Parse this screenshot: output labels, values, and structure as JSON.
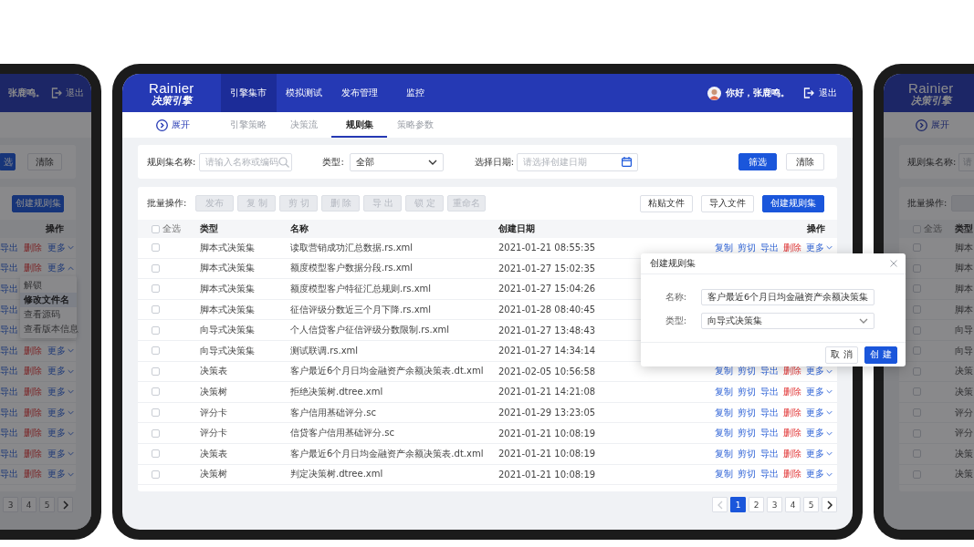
{
  "main": {
    "header": {
      "logo": {
        "latin": "Rainier",
        "chinese": "决策引擎"
      },
      "nav": [
        {
          "label": "引擎集市",
          "selected": true
        },
        {
          "label": "模拟测试",
          "selected": false
        },
        {
          "label": "发布管理",
          "selected": false
        },
        {
          "label": "监控",
          "selected": false
        }
      ],
      "greeting": "你好，张鹿鸣。",
      "logout": "退出"
    },
    "subnav": {
      "expand": "展开",
      "tabs": [
        {
          "label": "引擎策略",
          "selected": false
        },
        {
          "label": "决策流",
          "selected": false
        },
        {
          "label": "规则集",
          "selected": true
        },
        {
          "label": "策略参数",
          "selected": false
        }
      ]
    },
    "filter": {
      "name_field": {
        "label": "规则集名称:",
        "placeholder": "请输入名称或编码"
      },
      "type_field": {
        "label": "类型:",
        "value": "全部"
      },
      "date_field": {
        "label": "选择日期:",
        "placeholder": "请选择创建日期"
      },
      "buttons": [
        {
          "label": "筛选",
          "kind": "primary"
        },
        {
          "label": "清除",
          "kind": "default"
        }
      ]
    },
    "batch": {
      "label": "批量操作:",
      "buttons": [
        {
          "label": "发布",
          "disabled": true
        },
        {
          "label": "复 制",
          "disabled": true
        },
        {
          "label": "剪 切",
          "disabled": true
        },
        {
          "label": "删 除",
          "disabled": true
        },
        {
          "label": "导 出",
          "disabled": true
        },
        {
          "label": "锁 定",
          "disabled": true
        },
        {
          "label": "重命名",
          "disabled": true
        }
      ],
      "actions": [
        {
          "label": "粘贴文件",
          "kind": "default"
        },
        {
          "label": "导入文件",
          "kind": "default"
        },
        {
          "label": "创建规则集",
          "kind": "primary"
        }
      ]
    },
    "table": {
      "select_all": {
        "label": "全选",
        "checked": false
      },
      "columns": [
        "类型",
        "名称",
        "创建日期",
        "操作"
      ],
      "rows": [
        {
          "checked": false,
          "type": "脚本式决策集",
          "name": "读取营销成功汇总数据.rs.xml",
          "date": "2021-01-21 08:55:35",
          "actions": [
            {
              "label": "复制",
              "kind": "link"
            },
            {
              "label": "剪切",
              "kind": "link"
            },
            {
              "label": "导出",
              "kind": "link"
            },
            {
              "label": "删除",
              "kind": "danger"
            },
            {
              "label": "更多",
              "kind": "more",
              "expanded": false
            }
          ]
        },
        {
          "checked": false,
          "type": "脚本式决策集",
          "name": "额度模型客户数据分段.rs.xml",
          "date": "2021-01-27 15:02:35"
        },
        {
          "checked": false,
          "type": "脚本式决策集",
          "name": "额度模型客户特征汇总规则.rs.xml",
          "date": "2021-01-27 15:04:26"
        },
        {
          "checked": false,
          "type": "脚本式决策集",
          "name": "征信评级分数近三个月下降.rs.xml",
          "date": "2021-01-28 08:40:45"
        },
        {
          "checked": false,
          "type": "向导式决策集",
          "name": "个人信贷客户征信评级分数限制.rs.xml",
          "date": "2021-01-27 13:48:43"
        },
        {
          "checked": false,
          "type": "向导式决策集",
          "name": "测试联调.rs.xml",
          "date": "2021-01-27 14:34:14"
        },
        {
          "checked": false,
          "type": "决策表",
          "name": "客户最近6个月日均金融资产余额决策表.dt.xml",
          "date": "2021-02-05 10:56:58",
          "actions": [
            {
              "label": "复制",
              "kind": "link"
            },
            {
              "label": "剪切",
              "kind": "link"
            },
            {
              "label": "导出",
              "kind": "link"
            },
            {
              "label": "删除",
              "kind": "danger"
            },
            {
              "label": "更多",
              "kind": "more",
              "expanded": false
            }
          ]
        },
        {
          "checked": false,
          "type": "决策树",
          "name": "拒绝决策树.dtree.xml",
          "date": "2021-01-21 14:21:08",
          "actions": [
            {
              "label": "复制",
              "kind": "link"
            },
            {
              "label": "剪切",
              "kind": "link"
            },
            {
              "label": "导出",
              "kind": "link"
            },
            {
              "label": "删除",
              "kind": "danger"
            },
            {
              "label": "更多",
              "kind": "more",
              "expanded": false
            }
          ]
        },
        {
          "checked": false,
          "type": "评分卡",
          "name": "客户信用基础评分.sc",
          "date": "2021-01-29 13:23:05",
          "actions": [
            {
              "label": "复制",
              "kind": "link"
            },
            {
              "label": "剪切",
              "kind": "link"
            },
            {
              "label": "导出",
              "kind": "link"
            },
            {
              "label": "删除",
              "kind": "danger"
            },
            {
              "label": "更多",
              "kind": "more",
              "expanded": false
            }
          ]
        },
        {
          "checked": false,
          "type": "评分卡",
          "name": "信贷客户信用基础评分.sc",
          "date": "2021-01-21 10:08:19",
          "actions": [
            {
              "label": "复制",
              "kind": "link"
            },
            {
              "label": "剪切",
              "kind": "link"
            },
            {
              "label": "导出",
              "kind": "link"
            },
            {
              "label": "删除",
              "kind": "danger"
            },
            {
              "label": "更多",
              "kind": "more",
              "expanded": false
            }
          ]
        },
        {
          "checked": false,
          "type": "决策表",
          "name": "客户最近6个月日均金融资产余额决策表.dt.xml",
          "date": "2021-01-21 10:08:19",
          "actions": [
            {
              "label": "复制",
              "kind": "link"
            },
            {
              "label": "剪切",
              "kind": "link"
            },
            {
              "label": "导出",
              "kind": "link"
            },
            {
              "label": "删除",
              "kind": "danger"
            },
            {
              "label": "更多",
              "kind": "more",
              "expanded": false
            }
          ]
        },
        {
          "checked": false,
          "type": "决策树",
          "name": "判定决策树.dtree.xml",
          "date": "2021-01-21 10:08:19",
          "actions": [
            {
              "label": "复制",
              "kind": "link"
            },
            {
              "label": "剪切",
              "kind": "link"
            },
            {
              "label": "导出",
              "kind": "link"
            },
            {
              "label": "删除",
              "kind": "danger"
            },
            {
              "label": "更多",
              "kind": "more",
              "expanded": false
            }
          ]
        }
      ]
    },
    "pagination": {
      "prev": {
        "disabled": true
      },
      "pages": [
        {
          "label": "1",
          "selected": true
        },
        {
          "label": "2",
          "selected": false
        },
        {
          "label": "3",
          "selected": false
        },
        {
          "label": "4",
          "selected": false
        },
        {
          "label": "5",
          "selected": false
        }
      ],
      "next": {
        "disabled": false
      }
    }
  },
  "dialog": {
    "title": "创建规则集",
    "fields": [
      {
        "label": "名称:",
        "value": "客户最近6个月日均金融资产余额决策集",
        "kind": "input"
      },
      {
        "label": "类型:",
        "value": "向导式决策集",
        "kind": "select"
      }
    ],
    "buttons": [
      {
        "label": "取 消",
        "kind": "default"
      },
      {
        "label": "创 建",
        "kind": "primary"
      }
    ]
  },
  "left_preview": {
    "header": {
      "greeting": "张鹿鸣。",
      "logout": "退出"
    },
    "filter_buttons": [
      {
        "label": "选",
        "kind": "primary"
      },
      {
        "label": "清除",
        "kind": "default"
      }
    ],
    "batch_actions": [
      {
        "label": "创建规则集",
        "kind": "primary"
      }
    ],
    "table": {
      "columns": [
        "操作"
      ],
      "rows": [
        {
          "actions": [
            {
              "label": "导出",
              "kind": "link"
            },
            {
              "label": "删除",
              "kind": "danger"
            },
            {
              "label": "更多",
              "kind": "more",
              "expanded": false
            }
          ]
        },
        {
          "actions": [
            {
              "label": "导出",
              "kind": "link"
            },
            {
              "label": "删除",
              "kind": "danger"
            },
            {
              "label": "更多",
              "kind": "more",
              "expanded": true
            }
          ]
        },
        {
          "actions": [
            {
              "label": "导出",
              "kind": "link"
            }
          ]
        },
        {
          "actions": [
            {
              "label": "导出",
              "kind": "link"
            }
          ]
        },
        {
          "actions": [
            {
              "label": "导出",
              "kind": "link"
            }
          ]
        },
        {
          "actions": [
            {
              "label": "导出",
              "kind": "link"
            },
            {
              "label": "删除",
              "kind": "danger"
            },
            {
              "label": "更多",
              "kind": "more",
              "expanded": false
            }
          ]
        },
        {
          "actions": [
            {
              "label": "导出",
              "kind": "link"
            },
            {
              "label": "删除",
              "kind": "danger"
            },
            {
              "label": "更多",
              "kind": "more",
              "expanded": false
            }
          ]
        },
        {
          "actions": [
            {
              "label": "导出",
              "kind": "link"
            },
            {
              "label": "删除",
              "kind": "danger"
            },
            {
              "label": "更多",
              "kind": "more",
              "expanded": false
            }
          ]
        },
        {
          "actions": [
            {
              "label": "导出",
              "kind": "link"
            },
            {
              "label": "删除",
              "kind": "danger"
            },
            {
              "label": "更多",
              "kind": "more",
              "expanded": false
            }
          ]
        },
        {
          "actions": [
            {
              "label": "导出",
              "kind": "link"
            },
            {
              "label": "删除",
              "kind": "danger"
            },
            {
              "label": "更多",
              "kind": "more",
              "expanded": false
            }
          ]
        },
        {
          "actions": [
            {
              "label": "导出",
              "kind": "link"
            },
            {
              "label": "删除",
              "kind": "danger"
            },
            {
              "label": "更多",
              "kind": "more",
              "expanded": false
            }
          ]
        },
        {
          "actions": [
            {
              "label": "导出",
              "kind": "link"
            },
            {
              "label": "删除",
              "kind": "danger"
            },
            {
              "label": "更多",
              "kind": "more",
              "expanded": false
            }
          ]
        }
      ]
    },
    "menu": {
      "items": [
        {
          "label": "解锁",
          "selected": false
        },
        {
          "label": "修改文件名",
          "selected": true
        },
        {
          "label": "查看源码",
          "selected": false
        },
        {
          "label": "查看版本信息",
          "selected": false
        }
      ]
    },
    "pagination": {
      "pages": [
        {
          "label": "3",
          "selected": false
        },
        {
          "label": "4",
          "selected": false
        },
        {
          "label": "5",
          "selected": false
        }
      ],
      "next": {
        "disabled": false
      }
    }
  },
  "right_preview": {
    "logo": {
      "latin": "Rainier",
      "chinese": "决策引擎"
    },
    "expand": "展开",
    "name_field": {
      "label": "规则集名称:",
      "placeholder": "请"
    },
    "batch": {
      "label": "批量操作:",
      "buttons": [
        {
          "disabled": true
        }
      ]
    },
    "table": {
      "select_all": {
        "label": "全选",
        "checked": false
      },
      "columns": [
        "类型"
      ],
      "rows": [
        {
          "checked": false,
          "type": "脚本"
        },
        {
          "checked": false,
          "type": "脚本"
        },
        {
          "checked": false,
          "type": "脚本"
        },
        {
          "checked": false,
          "type": "脚本"
        },
        {
          "checked": false,
          "type": "向导"
        },
        {
          "checked": false,
          "type": "向导"
        },
        {
          "checked": false,
          "type": "决策"
        },
        {
          "checked": false,
          "type": "决策"
        },
        {
          "checked": false,
          "type": "评分"
        },
        {
          "checked": false,
          "type": "评分"
        },
        {
          "checked": false,
          "type": "决策"
        },
        {
          "checked": false,
          "type": "决策"
        }
      ]
    }
  }
}
